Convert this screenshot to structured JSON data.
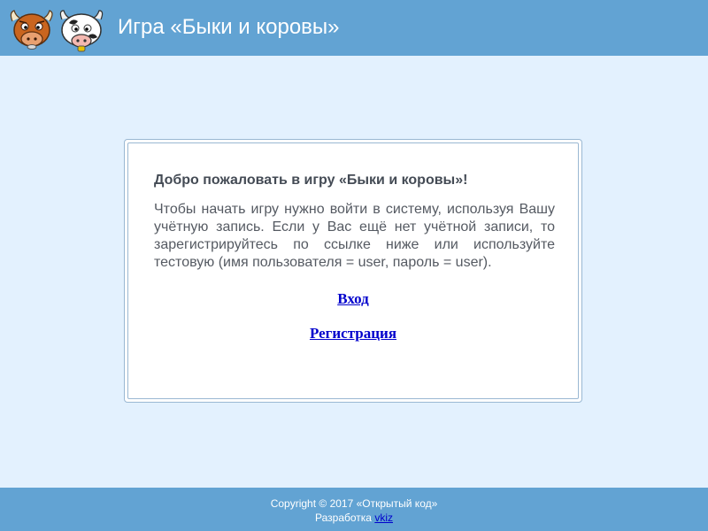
{
  "header": {
    "title": "Игра «Быки и коровы»",
    "logo_icon": "bull-and-cow-logo",
    "background_color": "#62a3d3"
  },
  "panel": {
    "welcome": "Добро пожаловать в игру «Быки и коровы»!",
    "description": "Чтобы начать игру нужно войти в систему, используя Вашу учётную запись. Если у Вас ещё нет учётной записи, то зарегистрируйтесь по ссылке ниже или используйте тестовую (имя пользователя = user, пароль = user).",
    "login_link": "Вход",
    "register_link": "Регистрация"
  },
  "footer": {
    "copyright": "Copyright © 2017 «Открытый код»",
    "developer_prefix": "Разработка",
    "developer_link": "vkiz"
  },
  "colors": {
    "page_background": "#e3f1fe",
    "link": "#0000cc"
  }
}
